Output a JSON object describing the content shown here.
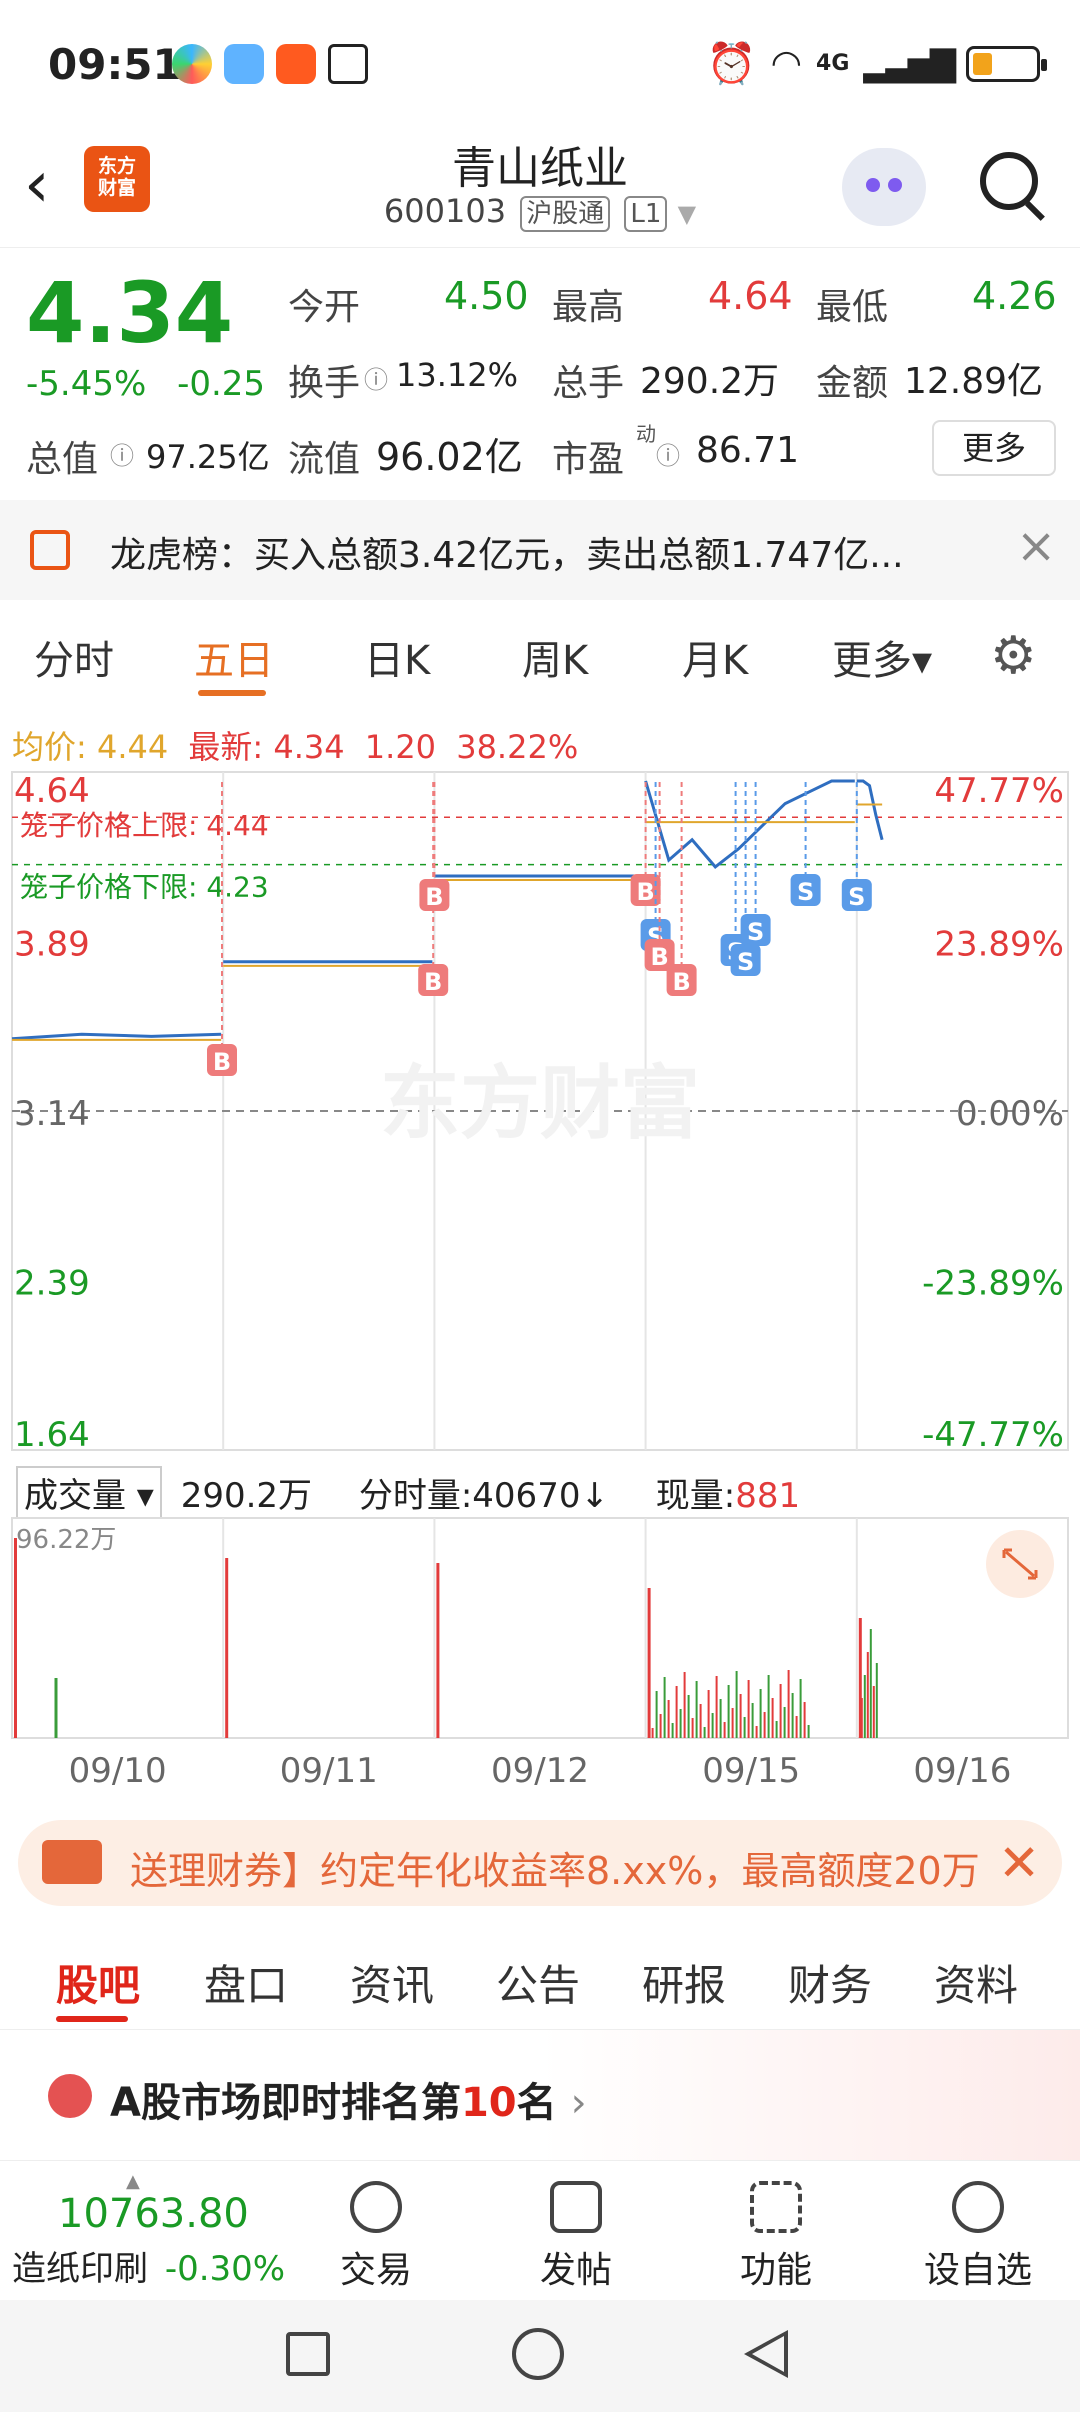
{
  "status": {
    "time": "09:51",
    "signal_text": "4G",
    "battery_level": 0.3
  },
  "header": {
    "title": "青山纸业",
    "code": "600103",
    "tag1": "沪股通",
    "tag2": "L1",
    "logo_line1": "东方",
    "logo_line2": "财富"
  },
  "quote": {
    "price": "4.34",
    "pct": "-5.45%",
    "chg": "-0.25",
    "open_label": "今开",
    "open": "4.50",
    "high_label": "最高",
    "high": "4.64",
    "low_label": "最低",
    "low": "4.26",
    "turnover_label": "换手",
    "turnover": "13.12%",
    "volume_label": "总手",
    "volume": "290.2万",
    "amount_label": "金额",
    "amount": "12.89亿",
    "mcap_label": "总值",
    "mcap": "97.25亿",
    "float_label": "流值",
    "float": "96.02亿",
    "pe_label": "市盈",
    "pe_sup": "动",
    "pe": "86.71",
    "more": "更多"
  },
  "notice": {
    "text": "龙虎榜：买入总额3.42亿元，卖出总额1.747亿..."
  },
  "tabs": [
    "分时",
    "五日",
    "日K",
    "周K",
    "月K",
    "更多▾"
  ],
  "active_tab": "五日",
  "chart_info": {
    "avg_label": "均价:",
    "avg": "4.44",
    "latest_label": "最新:",
    "latest": "4.34",
    "chg": "1.20",
    "pct": "38.22%"
  },
  "chart_data": {
    "type": "line",
    "y_ticks_left": [
      "4.64",
      "3.89",
      "3.14",
      "2.39",
      "1.64"
    ],
    "y_ticks_right": [
      "47.77%",
      "23.89%",
      "0.00%",
      "-23.89%",
      "-47.77%"
    ],
    "ylim": [
      1.64,
      4.64
    ],
    "cage_upper_label": "笼子价格上限:",
    "cage_upper": "4.44",
    "cage_lower_label": "笼子价格下限:",
    "cage_lower": "4.23",
    "watermark": "东方财富",
    "days": [
      "09/10",
      "09/11",
      "09/12",
      "09/15",
      "09/16"
    ],
    "series": [
      {
        "values_by_day": [
          [
            3.46,
            3.48,
            3.47,
            3.48
          ],
          [
            3.8,
            3.8,
            3.8,
            3.8
          ],
          [
            4.18,
            4.18,
            4.18,
            4.18
          ],
          [
            4.6,
            4.25,
            4.34,
            4.22,
            4.3,
            4.4,
            4.5,
            4.55,
            4.6,
            4.6
          ],
          [
            4.6,
            4.6,
            4.58,
            4.45,
            4.34
          ]
        ]
      }
    ],
    "signals": [
      "B",
      "B",
      "B",
      "B",
      "S",
      "B",
      "B",
      "S",
      "S",
      "S",
      "S",
      "S"
    ]
  },
  "volume": {
    "dropdown": "成交量",
    "total": "290.2万",
    "tick_vol": "分时量:40670↓",
    "now_label": "现量:",
    "now": "881",
    "max_label": "96.22万"
  },
  "promo": {
    "text": "送理财券】约定年化收益率8.xx%，最高额度20万"
  },
  "sections": [
    "股吧",
    "盘口",
    "资讯",
    "公告",
    "研报",
    "财务",
    "资料"
  ],
  "rank": {
    "prefix": "A股市场即时排名第",
    "num": "10",
    "suffix": "名"
  },
  "bottom": {
    "index_value": "10763.80",
    "index_name": "造纸印刷",
    "index_pct": "-0.30%",
    "items": [
      "交易",
      "发帖",
      "功能",
      "设自选"
    ]
  }
}
